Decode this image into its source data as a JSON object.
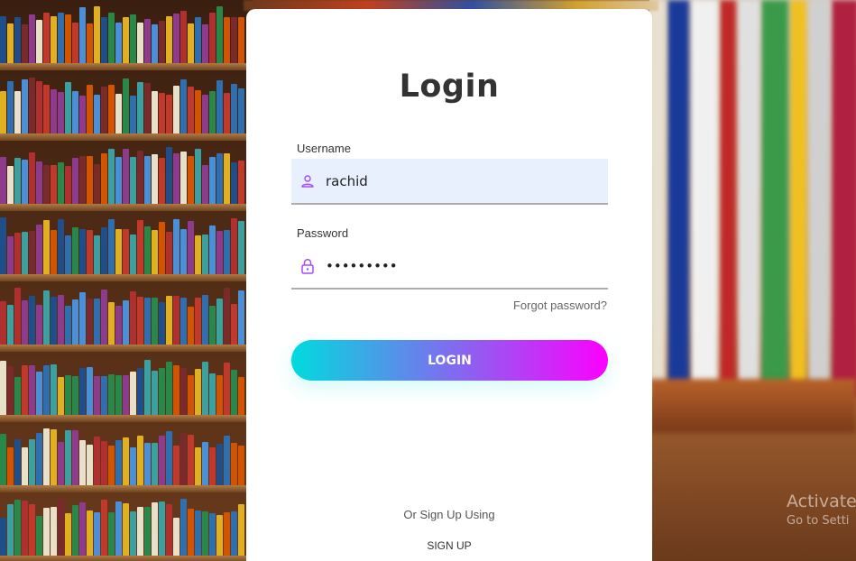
{
  "login": {
    "title": "Login",
    "username": {
      "label": "Username",
      "value": "rachid",
      "icon": "user-icon"
    },
    "password": {
      "label": "Password",
      "value": "•••••••••",
      "icon": "lock-icon"
    },
    "forgot_label": "Forgot password?",
    "button_label": "LOGIN",
    "alt_text": "Or Sign Up Using",
    "signup_label": "SIGN UP"
  },
  "watermark": {
    "line1": "Activate",
    "line2": "Go to Setti"
  },
  "colors": {
    "gradient_start": "#00dbde",
    "gradient_end": "#fc00ff",
    "icon": "#a64bf4",
    "input_fill": "#e8f0fe"
  }
}
